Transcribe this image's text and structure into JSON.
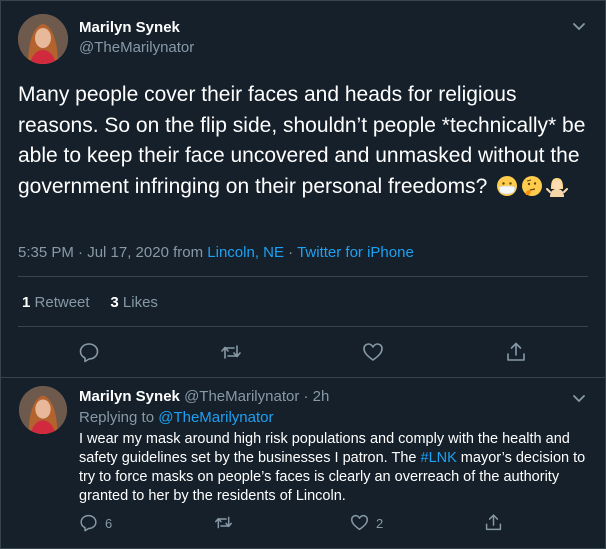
{
  "tweet": {
    "author_name": "Marilyn Synek",
    "author_handle": "@TheMarilynator",
    "text": "Many people cover their faces and heads for religious reasons. So on the flip side, shouldn’t  people *technically* be able to keep their face uncovered and unmasked without the government infringing on their personal freedoms?",
    "emojis": [
      "mask-face-emoji",
      "thinking-face-emoji",
      "shrugging-woman-emoji"
    ],
    "time": "5:35 PM · Jul 17, 2020",
    "from_word": "from",
    "location": "Lincoln, NE",
    "separator": "·",
    "source": "Twitter for iPhone",
    "retweets": "1",
    "retweets_label": "Retweet",
    "likes": "3",
    "likes_label": "Likes"
  },
  "reply": {
    "author_name": "Marilyn Synek",
    "author_handle": "@TheMarilynator",
    "age": "· 2h",
    "replying_to_label": "Replying to",
    "replying_to_handle": "@TheMarilynator",
    "text_before": "I wear my mask around high risk populations and comply with the health and safety guidelines set by the businesses I patron. The ",
    "hashtag": "#LNK",
    "text_after": " mayor’s decision to try to force masks on people’s faces is clearly an overreach of the authority granted to her by the residents of Lincoln.",
    "reply_count": "6",
    "like_count": "2"
  },
  "colors": {
    "background": "#15202b",
    "border": "#38444d",
    "secondary_text": "#8899a6",
    "accent": "#1da1f2"
  }
}
